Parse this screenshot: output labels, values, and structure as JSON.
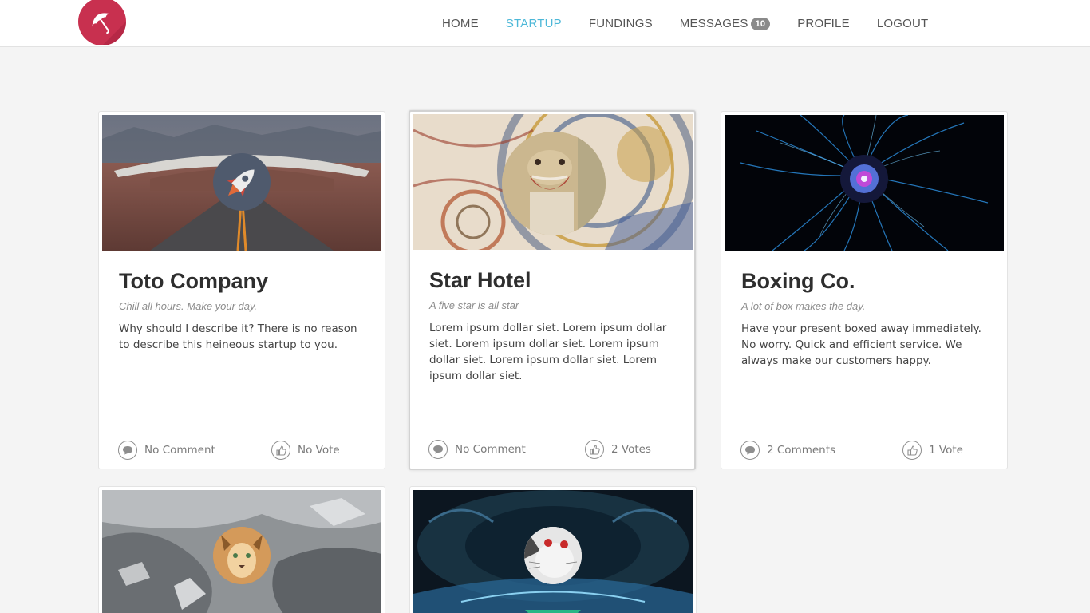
{
  "header": {
    "logo": "umbrella-icon",
    "nav": [
      {
        "label": "HOME",
        "active": false
      },
      {
        "label": "STARTUP",
        "active": true
      },
      {
        "label": "FUNDINGS",
        "active": false
      },
      {
        "label": "MESSAGES",
        "active": false,
        "badge": "10"
      },
      {
        "label": "PROFILE",
        "active": false
      },
      {
        "label": "LOGOUT",
        "active": false
      }
    ]
  },
  "colors": {
    "accent": "#4db8d8",
    "brand": "#c8304f",
    "badge": "#8a8a8a"
  },
  "cards": [
    {
      "title": "Toto Company",
      "tagline": "Chill all hours. Make your day.",
      "description": "Why should I describe it? There is no reason to describe this heineous startup to you.",
      "comments": "No Comment",
      "votes": "No Vote",
      "avatar": "rocket-icon"
    },
    {
      "title": "Star Hotel",
      "tagline": "A five star is all star",
      "description": "Lorem ipsum dollar siet. Lorem ipsum dollar siet. Lorem ipsum dollar siet. Lorem ipsum dollar siet. Lorem ipsum dollar siet. Lorem ipsum dollar siet.",
      "comments": "No Comment",
      "votes": "2 Votes",
      "avatar": "lizard-photo",
      "selected": true
    },
    {
      "title": "Boxing Co.",
      "tagline": "A lot of box makes the day.",
      "description": "Have your present boxed away immediately. No worry. Quick and efficient service. We always make our customers happy.",
      "comments": "2 Comments",
      "votes": "1 Vote",
      "avatar": "mandala-icon"
    },
    {
      "avatar": "cougar-photo"
    },
    {
      "avatar": "cat-photo"
    }
  ]
}
